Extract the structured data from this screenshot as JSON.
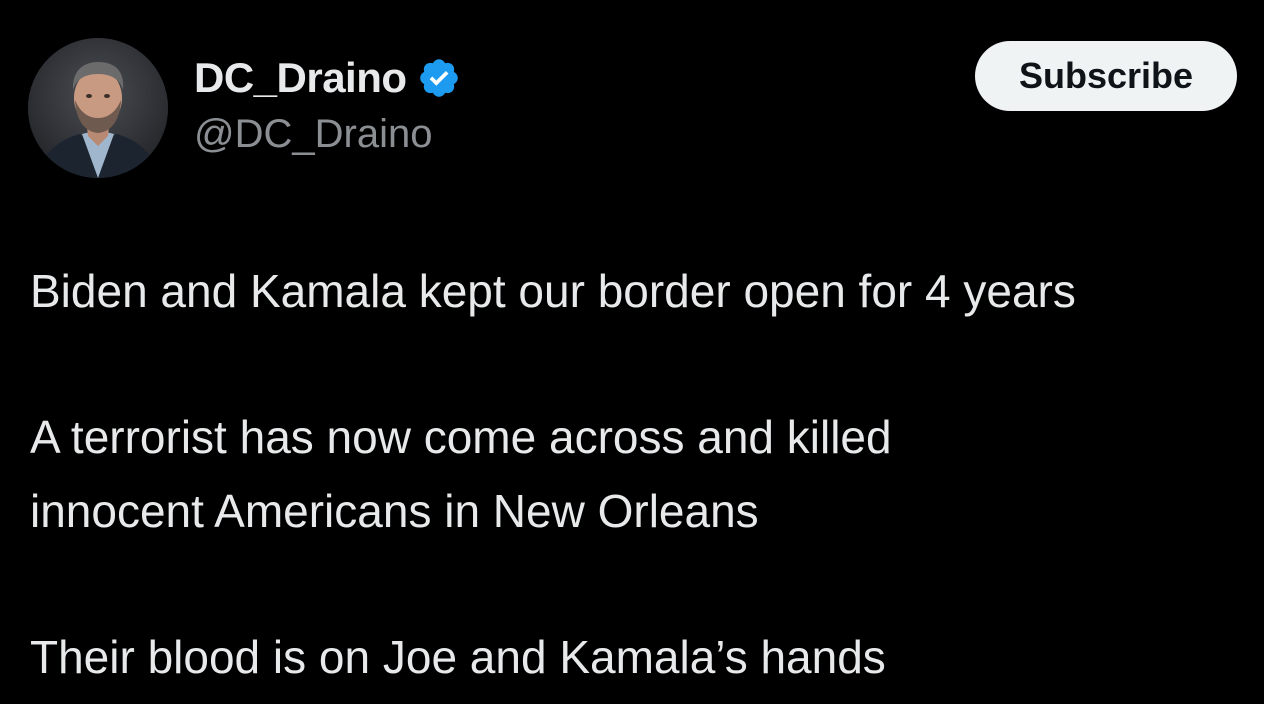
{
  "author": {
    "display_name": "DC_Draino",
    "handle": "@DC_Draino",
    "verified": true,
    "verified_badge_color": "#1d9bf0",
    "avatar_icon": "profile-photo"
  },
  "actions": {
    "subscribe_label": "Subscribe"
  },
  "post": {
    "paragraphs": [
      {
        "lines": [
          "Biden and Kamala kept our border open for 4 years"
        ]
      },
      {
        "lines": [
          "A terrorist has now come across and killed",
          "innocent Americans in New Orleans"
        ]
      },
      {
        "lines": [
          "Their blood is on Joe and Kamala’s hands"
        ]
      }
    ]
  },
  "colors": {
    "background": "#000000",
    "primary_text": "#e7e9ea",
    "secondary_text": "#8b8f94",
    "button_bg": "#eff3f4",
    "button_text": "#0f1419"
  }
}
